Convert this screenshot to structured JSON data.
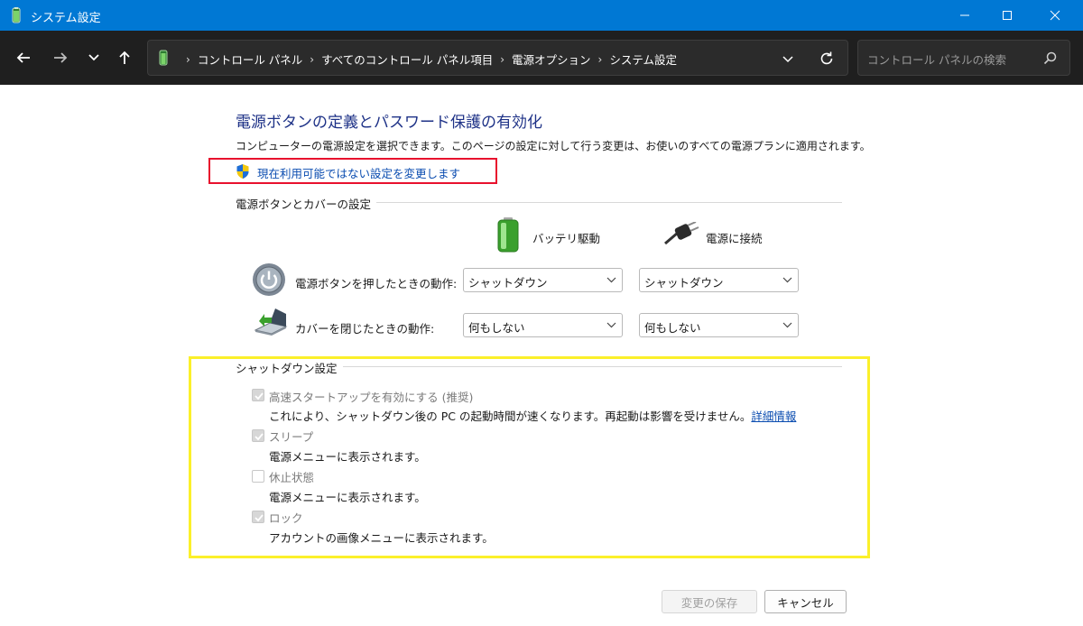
{
  "window": {
    "title": "システム設定"
  },
  "address_bar": {
    "breadcrumbs": [
      "コントロール パネル",
      "すべてのコントロール パネル項目",
      "電源オプション",
      "システム設定"
    ],
    "search_placeholder": "コントロール パネルの検索"
  },
  "page": {
    "heading": "電源ボタンの定義とパスワード保護の有効化",
    "description": "コンピューターの電源設定を選択できます。このページの設定に対して行う変更は、お使いのすべての電源プランに適用されます。",
    "change_unavailable_link": "現在利用可能ではない設定を変更します"
  },
  "power_buttons": {
    "section_title": "電源ボタンとカバーの設定",
    "columns": [
      "バッテリ駆動",
      "電源に接続"
    ],
    "rows": [
      {
        "label": "電源ボタンを押したときの動作:",
        "battery": "シャットダウン",
        "plugged": "シャットダウン"
      },
      {
        "label": "カバーを閉じたときの動作:",
        "battery": "何もしない",
        "plugged": "何もしない"
      }
    ]
  },
  "shutdown": {
    "section_title": "シャットダウン設定",
    "items": [
      {
        "label": "高速スタートアップを有効にする (推奨)",
        "checked": true,
        "description": "これにより、シャットダウン後の PC の起動時間が速くなります。再起動は影響を受けません。",
        "link": "詳細情報"
      },
      {
        "label": "スリープ",
        "checked": true,
        "description": "電源メニューに表示されます。"
      },
      {
        "label": "休止状態",
        "checked": false,
        "description": "電源メニューに表示されます。"
      },
      {
        "label": "ロック",
        "checked": true,
        "description": "アカウントの画像メニューに表示されます。"
      }
    ]
  },
  "buttons": {
    "save": "変更の保存",
    "cancel": "キャンセル"
  },
  "annotations": {
    "red_box_color": "#e8112d",
    "yellow_box_color": "#fbf02a"
  },
  "colors": {
    "titlebar": "#0078d4",
    "navbar": "#1f1f1f",
    "heading": "#1e3287",
    "link": "#0a4cb0"
  }
}
